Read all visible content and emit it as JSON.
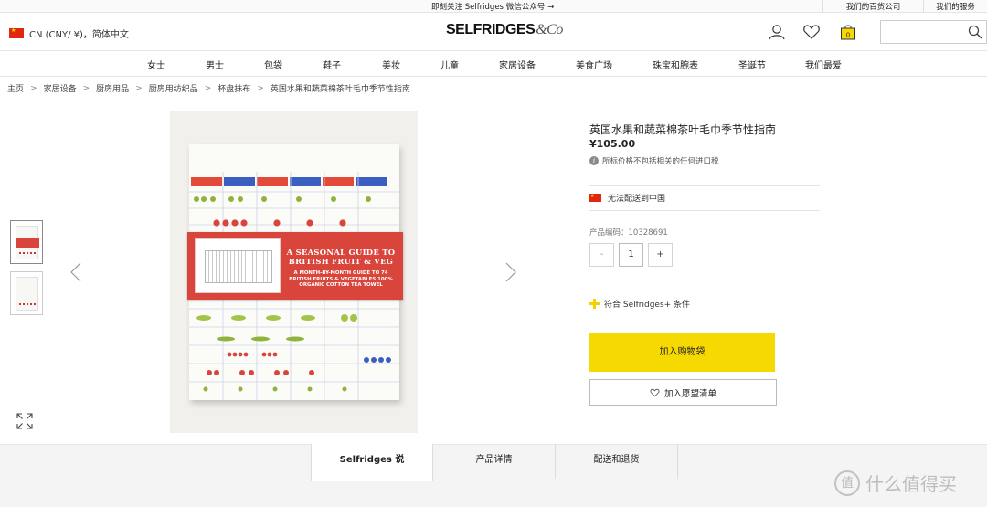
{
  "topbar": {
    "promo_text": "即刻关注 Selfridges 微信公众号",
    "promo_arrow": "→",
    "link_stores": "我们的百货公司",
    "link_services": "我们的服务"
  },
  "header": {
    "locale": "CN (CNY/ ¥)，简体中文",
    "logo_main": "SELFRIDGES",
    "logo_suffix": "&Co",
    "bag_count": "0"
  },
  "nav": {
    "items": [
      "女士",
      "男士",
      "包袋",
      "鞋子",
      "美妆",
      "儿童",
      "家居设备",
      "美食广场",
      "珠宝和腕表",
      "圣诞节",
      "我们最爱"
    ]
  },
  "breadcrumb": {
    "items": [
      "主页",
      "家居设备",
      "厨房用品",
      "厨房用纺织品",
      "杯盘抹布",
      "英国水果和蔬菜棉茶叶毛巾季节性指南"
    ],
    "separator": ">"
  },
  "product_image": {
    "band_title": "A SEASONAL GUIDE TO BRITISH FRUIT & VEG",
    "band_subtitle": "A MONTH-BY-MONTH GUIDE TO 74 BRITISH FRUITS & VEGETABLES 100% ORGANIC COTTON TEA TOWEL"
  },
  "product": {
    "name": "英国水果和蔬菜棉茶叶毛巾季节性指南",
    "price": "¥105.00",
    "tax_note": "所标价格不包括相关的任何进口税",
    "shipping": "无法配送到中国",
    "sku_label": "产品编码：10328691",
    "qty_minus": "-",
    "qty_value": "1",
    "qty_plus": "+",
    "plus_terms": "符合 Selfridges+ 条件",
    "add_to_bag": "加入购物袋",
    "add_to_wishlist": "加入愿望清单"
  },
  "tabs": {
    "items": [
      "Selfridges 说",
      "产品详情",
      "配送和退货"
    ],
    "active": 0
  },
  "watermark": {
    "text": "什么值得买",
    "logo_glyph": "值"
  },
  "colors": {
    "accent_yellow": "#f6d900",
    "flag_red": "#de2910",
    "band_red": "#d9453b"
  }
}
